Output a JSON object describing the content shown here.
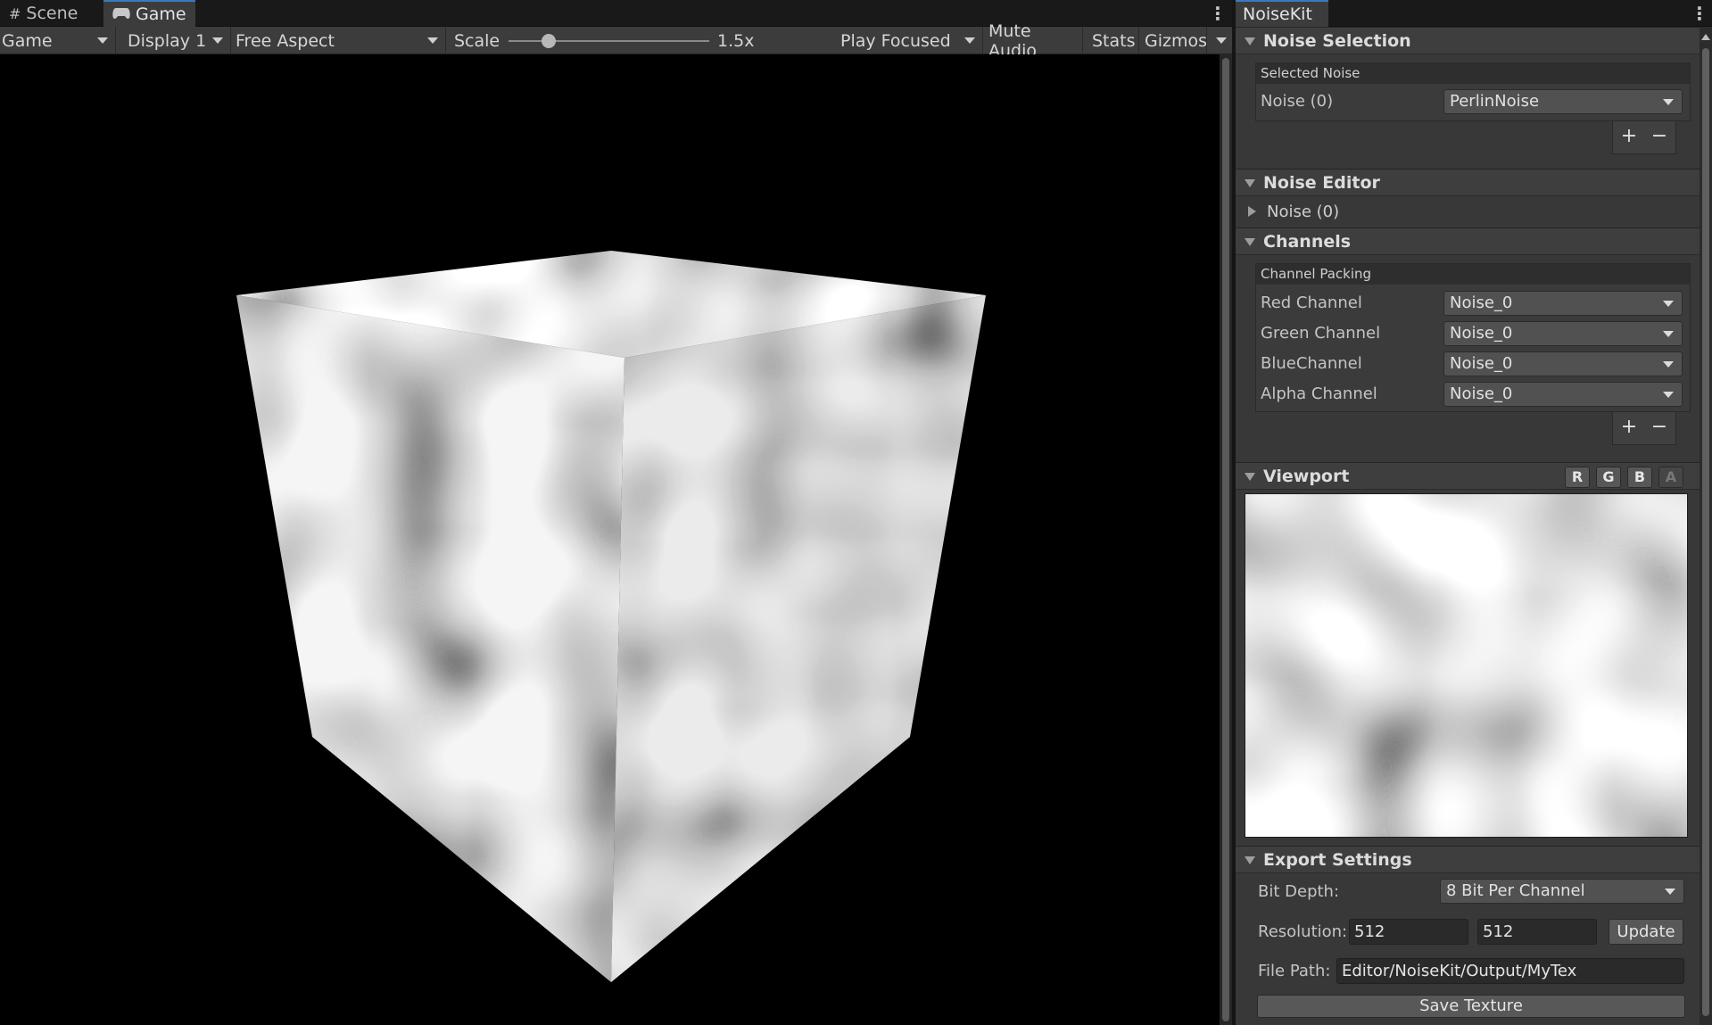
{
  "game_window": {
    "tabs": [
      {
        "label": "Scene",
        "icon": "hash-grid-icon"
      },
      {
        "label": "Game",
        "icon": "gamepad-icon"
      }
    ],
    "toolbar": {
      "mode": "Game",
      "display": "Display 1",
      "aspect": "Free Aspect",
      "scale_label": "Scale",
      "scale_value": "1.5x",
      "scale_slider_fraction": 0.2,
      "play_mode": "Play Focused",
      "mute_audio": "Mute Audio",
      "stats": "Stats",
      "gizmos": "Gizmos"
    }
  },
  "noisekit": {
    "tab_title": "NoiseKit",
    "noise_selection": {
      "title": "Noise Selection",
      "group_title": "Selected Noise",
      "row_label": "Noise (0)",
      "row_value": "PerlinNoise",
      "add": "+",
      "remove": "−"
    },
    "noise_editor": {
      "title": "Noise Editor",
      "item": "Noise (0)"
    },
    "channels": {
      "title": "Channels",
      "group_title": "Channel Packing",
      "rows": [
        {
          "label": "Red Channel",
          "value": "Noise_0"
        },
        {
          "label": "Green Channel",
          "value": "Noise_0"
        },
        {
          "label": "BlueChannel",
          "value": "Noise_0"
        },
        {
          "label": "Alpha Channel",
          "value": "Noise_0"
        }
      ],
      "add": "+",
      "remove": "−"
    },
    "viewport": {
      "title": "Viewport",
      "buttons": [
        "R",
        "G",
        "B",
        "A"
      ]
    },
    "export": {
      "title": "Export Settings",
      "bit_depth_label": "Bit Depth:",
      "bit_depth_value": "8 Bit Per Channel",
      "resolution_label": "Resolution:",
      "res_x": "512",
      "res_y": "512",
      "update": "Update",
      "file_path_label": "File Path:",
      "file_path": "Editor/NoiseKit/Output/MyTex",
      "save": "Save Texture"
    }
  },
  "colors": {
    "panel_bg": "#383838",
    "header_bg": "#3e3e3e",
    "accent_tab": "#3a79bb",
    "field_bg": "#2a2a2a"
  }
}
